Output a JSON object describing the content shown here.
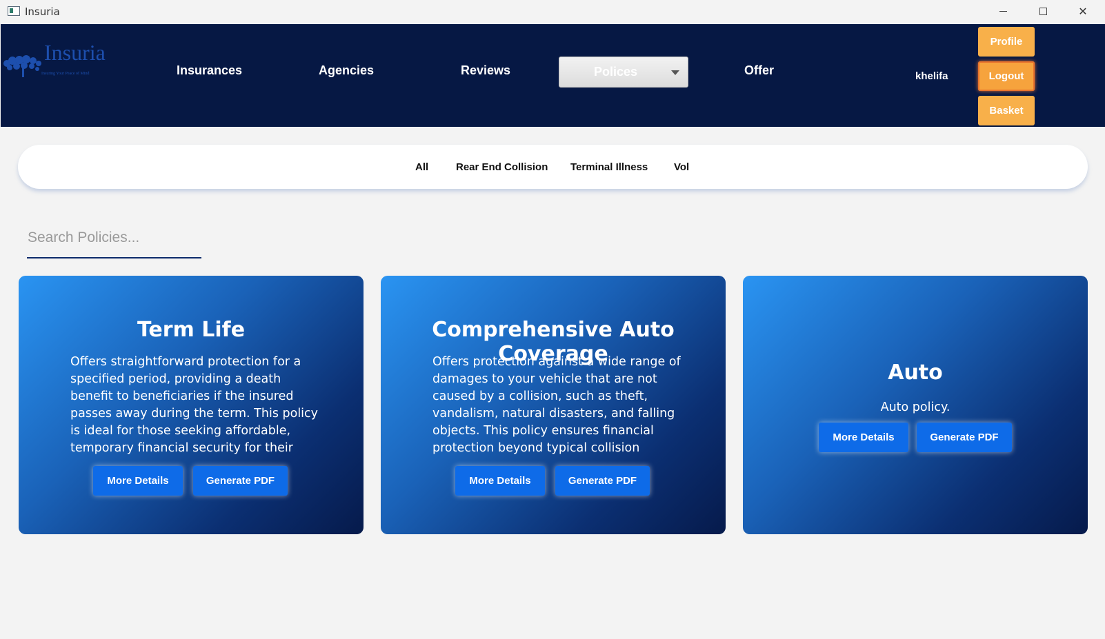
{
  "window": {
    "title": "Insuria"
  },
  "header": {
    "logo_text": "Insuria",
    "logo_tagline": "Insuring Your Peace of Mind",
    "nav": {
      "insurances": "Insurances",
      "agencies": "Agencies",
      "reviews": "Reviews",
      "policies": "Polices",
      "offer": "Offer"
    },
    "username": "khelifa",
    "buttons": {
      "profile": "Profile",
      "logout": "Logout",
      "basket": "Basket"
    }
  },
  "filters": [
    "All",
    "Rear End Collision",
    "Terminal Illness",
    "Vol"
  ],
  "search": {
    "placeholder": "Search Policies..."
  },
  "cards": [
    {
      "title": "Term Life",
      "description": "Offers straightforward protection for a specified period, providing a death benefit to beneficiaries if the insured passes away during the term. This policy is ideal for those seeking affordable, temporary financial security for their loved ones.",
      "more_details": "More Details",
      "generate_pdf": "Generate PDF"
    },
    {
      "title": "Comprehensive Auto Coverage",
      "description": "Offers protection against a wide range of damages to your vehicle that are not caused by a collision, such as theft, vandalism, natural disasters, and falling objects. This policy ensures financial protection beyond typical collision incidents, making it",
      "more_details": "More Details",
      "generate_pdf": "Generate PDF"
    },
    {
      "title": "Auto",
      "description": "Auto policy.",
      "more_details": "More Details",
      "generate_pdf": "Generate PDF"
    }
  ],
  "colors": {
    "navbar": "#061844",
    "accent_orange": "#f8b04a",
    "button_blue": "#0e6be8",
    "card_gradient_start": "#2a94f2",
    "card_gradient_end": "#061a4b"
  }
}
